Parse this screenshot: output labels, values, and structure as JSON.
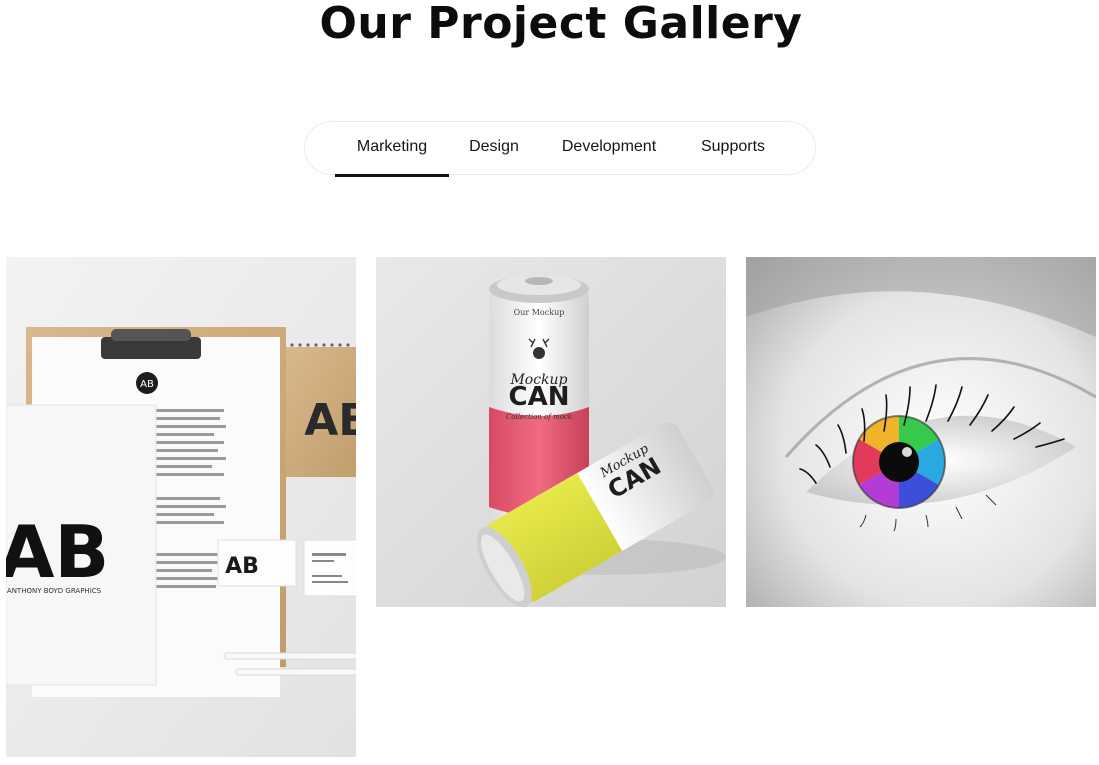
{
  "gallery": {
    "title": "Our Project Gallery",
    "tabs": [
      {
        "label": "Marketing",
        "active": true
      },
      {
        "label": "Design",
        "active": false
      },
      {
        "label": "Development",
        "active": false
      },
      {
        "label": "Supports",
        "active": false
      }
    ],
    "items": [
      {
        "image": "stationery-branding-mockup",
        "logo": "AB",
        "logo_caption": "ANTHONY BOYD GRAPHICS"
      },
      {
        "image": "soda-can-mockup",
        "can_top": "Our Mockup",
        "can_title_1": "Mockup",
        "can_title_2": "CAN",
        "can_subtitle": "Collection of mock"
      },
      {
        "image": "rainbow-eye-closeup"
      }
    ]
  }
}
